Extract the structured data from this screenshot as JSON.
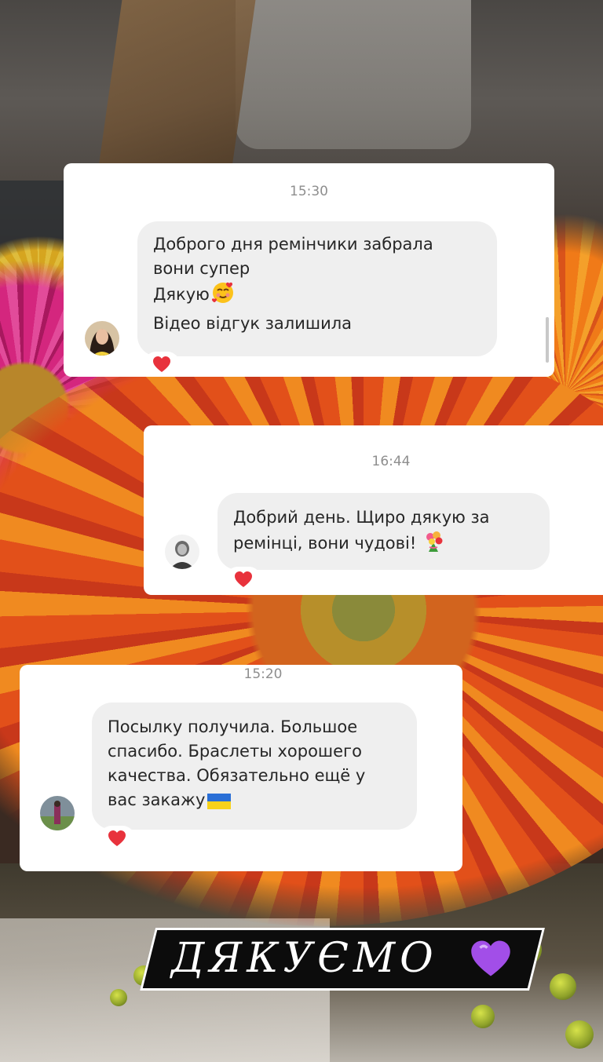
{
  "messages": [
    {
      "time": "15:30",
      "lines": [
        "Доброго дня ремінчики забрала",
        "вони супер",
        "Дякую",
        "Відео відгук залишила"
      ],
      "emoji_after_line": 2,
      "emoji": "smiling-face-with-hearts",
      "reaction": "heart"
    },
    {
      "time": "16:44",
      "lines": [
        "Добрий день. Щиро дякую за",
        "ремінці, вони чудові!"
      ],
      "emoji_after_line": 1,
      "emoji": "bouquet",
      "reaction": "heart"
    },
    {
      "time": "15:20",
      "lines": [
        "Посылку получила. Большое",
        "спасибо. Браслеты хорошего",
        "качества. Обязательно ещё у",
        "вас закажу"
      ],
      "emoji_after_line": 3,
      "emoji": "ukraine-flag",
      "reaction": "heart"
    }
  ],
  "caption": {
    "text": "ДЯКУЄМО",
    "emoji": "purple-heart"
  },
  "colors": {
    "card": "#ffffff",
    "bubble": "#efefef",
    "text": "#262626",
    "time": "#8e8e8e",
    "heart": "#e8323c",
    "purple_heart": "#a24ee8",
    "caption_bg": "#0c0c0c"
  }
}
